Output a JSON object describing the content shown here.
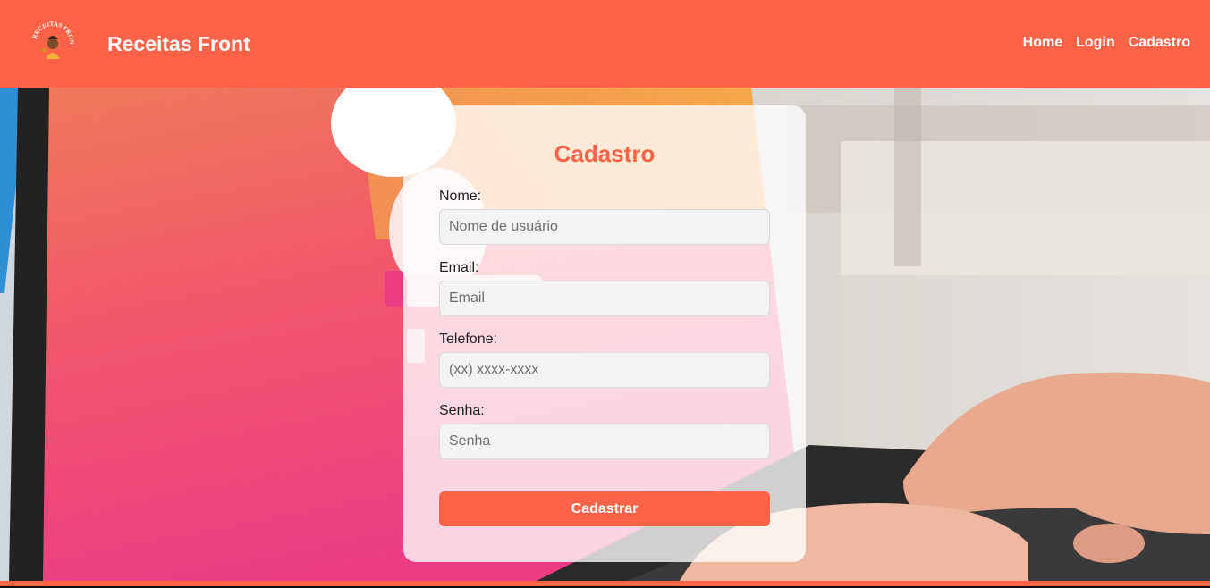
{
  "header": {
    "brand": "Receitas Front",
    "logo_text": "RECEITAS FRONT",
    "nav": [
      {
        "label": "Home"
      },
      {
        "label": "Login"
      },
      {
        "label": "Cadastro"
      }
    ],
    "color": "#ff6347"
  },
  "form": {
    "title": "Cadastro",
    "fields": [
      {
        "label": "Nome:",
        "placeholder": "Nome de usuário",
        "value": ""
      },
      {
        "label": "Email:",
        "placeholder": "Email",
        "value": ""
      },
      {
        "label": "Telefone:",
        "placeholder": "(xx) xxxx-xxxx",
        "value": ""
      },
      {
        "label": "Senha:",
        "placeholder": "Senha",
        "value": ""
      }
    ],
    "submit_label": "Cadastrar"
  },
  "colors": {
    "accent": "#ff6347",
    "card_bg": "rgba(255,255,255,0.78)"
  }
}
